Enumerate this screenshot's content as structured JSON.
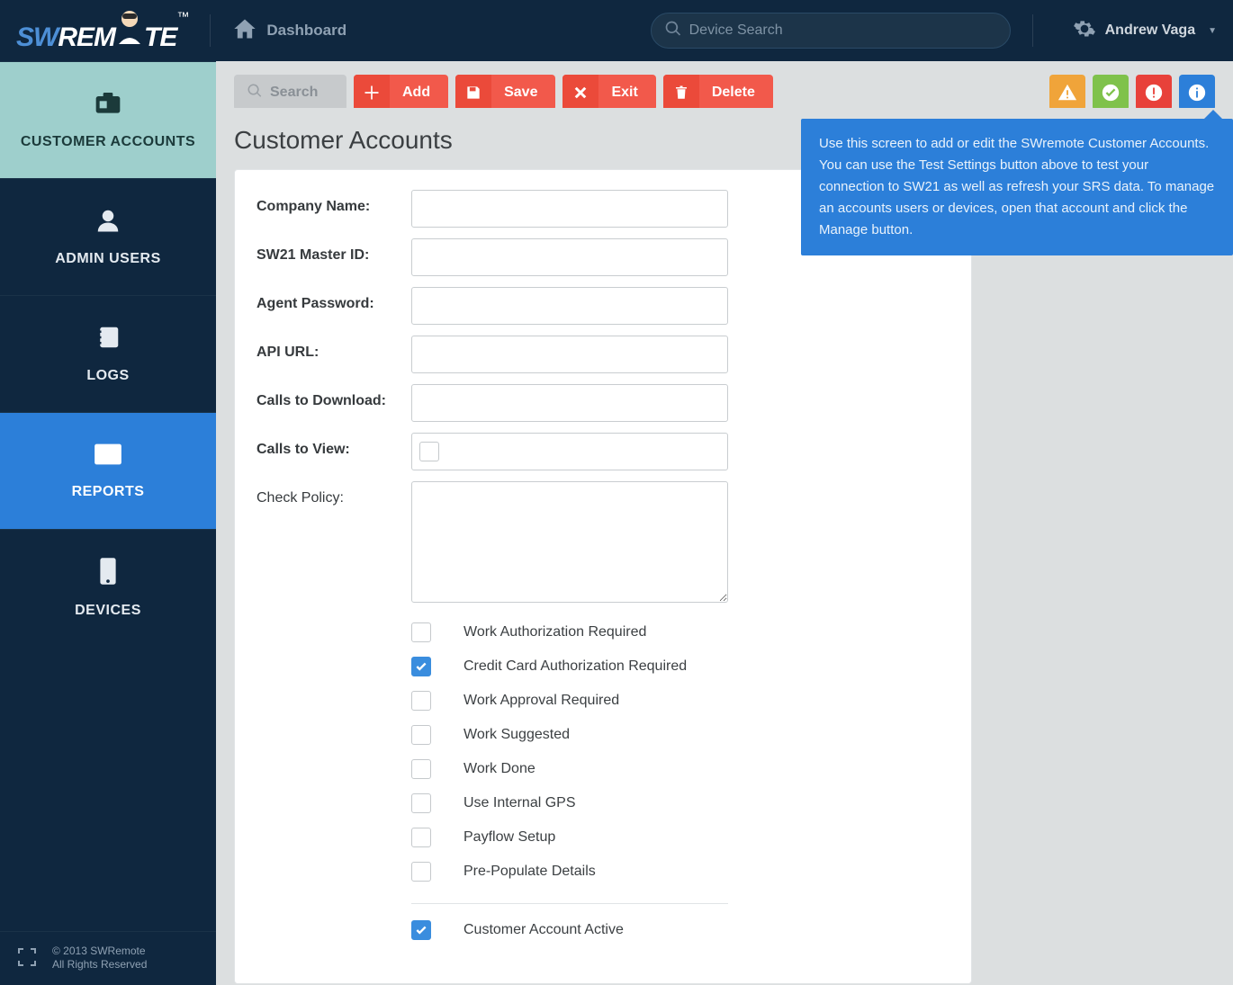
{
  "header": {
    "logo_prefix": "SW",
    "logo_mid": "REM",
    "logo_suffix": "TE",
    "breadcrumb": "Dashboard",
    "search_placeholder": "Device Search",
    "user_name": "Andrew Vaga"
  },
  "sidebar": {
    "items": [
      {
        "label": "CUSTOMER ACCOUNTS"
      },
      {
        "label": "ADMIN USERS"
      },
      {
        "label": "LOGS"
      },
      {
        "label": "REPORTS"
      },
      {
        "label": "DEVICES"
      }
    ],
    "footer_copyright": "© 2013 SWRemote",
    "footer_rights": "All Rights Reserved"
  },
  "toolbar": {
    "search_placeholder": "Search",
    "add": "Add",
    "save": "Save",
    "exit": "Exit",
    "delete": "Delete"
  },
  "info_text": "Use this screen to add or edit the SWremote Customer Accounts. You can use the Test Settings button above to test your connection to SW21 as well as refresh your SRS data. To manage an accounts users or devices, open that account and click the Manage button.",
  "page": {
    "title": "Customer Accounts",
    "fields": {
      "company_name": "Company Name:",
      "master_id": "SW21 Master ID:",
      "agent_password": "Agent Password:",
      "api_url": "API URL:",
      "calls_download": "Calls to Download:",
      "calls_view": "Calls to View:",
      "check_policy": "Check Policy:"
    },
    "options": [
      {
        "label": "Work Authorization Required",
        "checked": false
      },
      {
        "label": "Credit Card Authorization Required",
        "checked": true
      },
      {
        "label": "Work Approval Required",
        "checked": false
      },
      {
        "label": "Work Suggested",
        "checked": false
      },
      {
        "label": "Work Done",
        "checked": false
      },
      {
        "label": "Use Internal GPS",
        "checked": false
      },
      {
        "label": "Payflow Setup",
        "checked": false
      },
      {
        "label": "Pre-Populate Details",
        "checked": false
      }
    ],
    "active_option": {
      "label": "Customer Account Active",
      "checked": true
    }
  }
}
